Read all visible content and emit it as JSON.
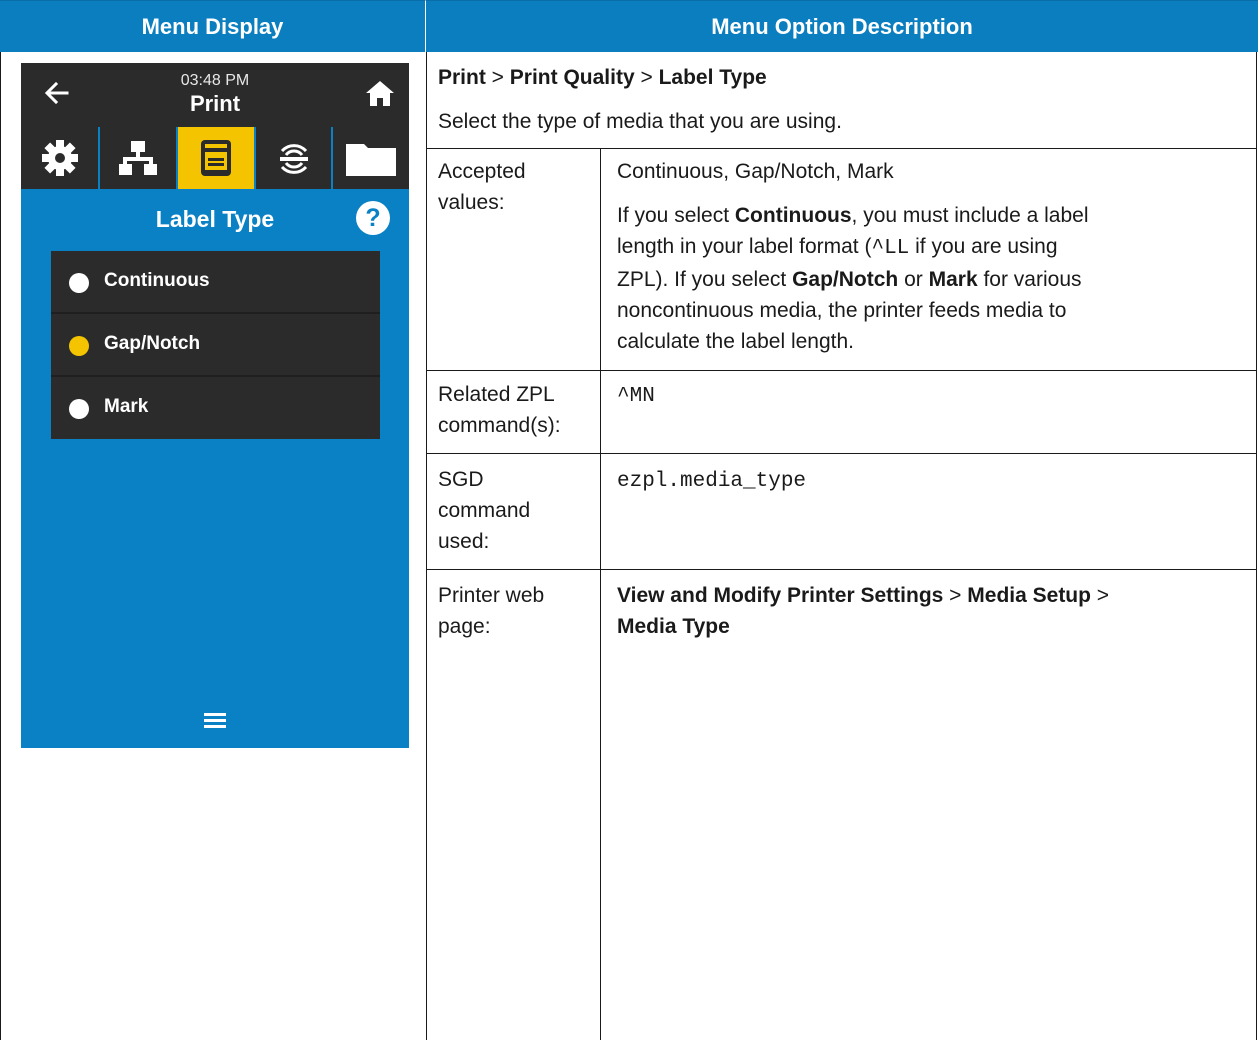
{
  "table": {
    "left_header": "Menu Display",
    "right_header": "Menu Option Description"
  },
  "device": {
    "time": "03:48 PM",
    "title": "Print",
    "tabs": [
      "gear-icon",
      "network-icon",
      "printer-icon",
      "rfid-icon",
      "folder-icon"
    ],
    "active_tab": "printer-icon",
    "screen_title": "Label Type",
    "help": "?",
    "options": [
      {
        "label": "Continuous",
        "selected": false
      },
      {
        "label": "Gap/Notch",
        "selected": true
      },
      {
        "label": "Mark",
        "selected": false
      }
    ],
    "colors": {
      "screen": "#0a80c5",
      "bar": "#2b2b2b",
      "accent": "#f5c400"
    }
  },
  "description": {
    "breadcrumb": {
      "p1": "Print",
      "sep": " > ",
      "p2": "Print Quality",
      "p3": "Label Type"
    },
    "intro": "Select the type of media that you are using.",
    "accepted": {
      "label_line1": "Accepted",
      "label_line2": "values:",
      "values": "Continuous, Gap/Notch, Mark",
      "note_a": "If you select ",
      "note_b": "Continuous",
      "note_c": ", you must include a label",
      "note_line2_a": "length in your label format (",
      "note_line2_code": "^LL",
      "note_line2_b": " if you are using",
      "note_line3_a": "ZPL). If you select ",
      "note_line3_b": "Gap/Notch",
      "note_line3_c": " or ",
      "note_line3_d": "Mark",
      "note_line3_e": " for various",
      "note_line4": "noncontinuous media, the printer feeds media to",
      "note_line5": "calculate the label length."
    },
    "zpl": {
      "label_line1": "Related ZPL",
      "label_line2": "command(s):",
      "value": "^MN"
    },
    "sgd": {
      "label_line1": "SGD",
      "label_line2": "command",
      "label_line3": "used:",
      "value": "ezpl.media_type"
    },
    "web": {
      "label_line1": "Printer web",
      "label_line2": "page:",
      "p1": "View and Modify Printer Settings",
      "sep": " > ",
      "p2": "Media Setup",
      "p3": "Media Type"
    }
  }
}
